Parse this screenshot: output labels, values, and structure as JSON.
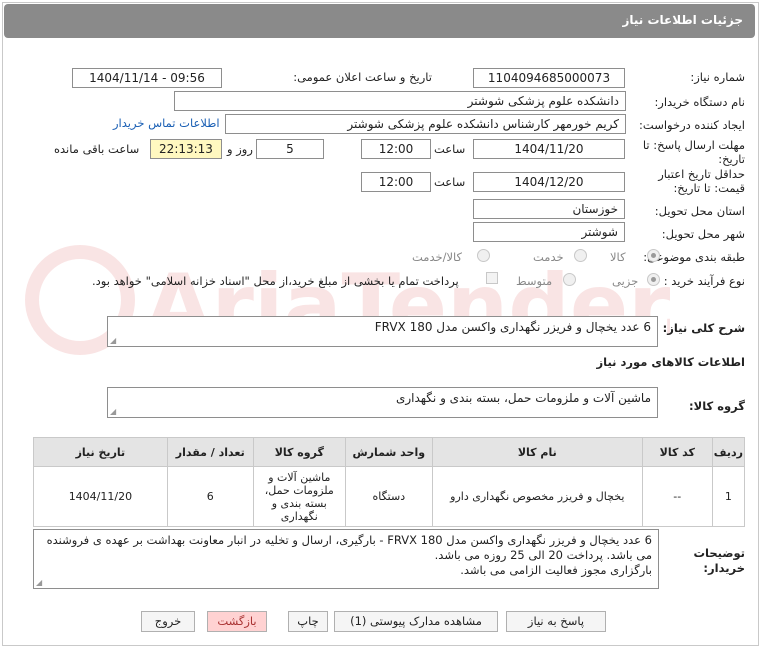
{
  "window": {
    "title": "جزئیات اطلاعات نیاز"
  },
  "labels": {
    "need_number": "شماره نیاز:",
    "announce_datetime": "تاریخ و ساعت اعلان عمومی:",
    "buyer_org": "نام دستگاه خریدار:",
    "requester": "ایجاد کننده درخواست:",
    "contact_link": "اطلاعات تماس خریدار",
    "reply_deadline_line1": "مهلت ارسال پاسخ: تا",
    "reply_deadline_line2": "تاریخ:",
    "time": "ساعت",
    "day_and": "روز و",
    "remaining": "ساعت باقی مانده",
    "min_validity_line1": "حداقل تاریخ اعتبار",
    "min_validity_line2": "قیمت: تا تاریخ:",
    "delivery_province": "استان محل تحویل:",
    "delivery_city": "شهر محل تحویل:",
    "category": "طبقه بندی موضوعی:",
    "process_type": "نوع فرآیند خرید :",
    "general_desc": "شرح کلی نیاز:",
    "goods_info": "اطلاعات کالاهای مورد نیاز",
    "goods_group": "گروه کالا:",
    "buyer_notes_line1": "توضیحات",
    "buyer_notes_line2": "خریدار:"
  },
  "values": {
    "need_number": "1104094685000073",
    "announce_datetime": "1404/11/14 - 09:56",
    "buyer_org": "دانشکده علوم پزشکی شوشتر",
    "requester": "کریم خورمهر کارشناس دانشکده علوم پزشکی شوشتر",
    "reply_date": "1404/11/20",
    "reply_time": "12:00",
    "reply_days": "5",
    "reply_remaining": "22:13:13",
    "validity_date": "1404/12/20",
    "validity_time": "12:00",
    "province": "خوزستان",
    "city": "شوشتر",
    "general_desc": "6 عدد یخچال و فریزر نگهداری واکسن مدل FRVX 180",
    "goods_group": "ماشین آلات و ملزومات حمل، بسته بندی و نگهداری",
    "buyer_notes": "6 عدد یخچال و فریزر نگهداری واکسن مدل FRVX 180 - بارگیری، ارسال و تخلیه در انبار معاونت بهداشت بر عهده ی فروشنده می باشد. پرداخت 20 الی 25 روزه می باشد.",
    "buyer_notes_2": "بارگزاری مجوز فعالیت الزامی می باشد."
  },
  "category_options": [
    {
      "label": "کالا",
      "selected": true
    },
    {
      "label": "خدمت",
      "selected": false
    },
    {
      "label": "کالا/خدمت",
      "selected": false
    }
  ],
  "process_options": [
    {
      "label": "جزیی",
      "selected": true
    },
    {
      "label": "متوسط",
      "selected": false
    }
  ],
  "process_note": "پرداخت تمام یا بخشی از مبلغ خرید،از محل \"اسناد خزانه اسلامی\" خواهد بود.",
  "table": {
    "headers": [
      "ردیف",
      "کد کالا",
      "نام کالا",
      "واحد شمارش",
      "گروه کالا",
      "تعداد / مقدار",
      "تاریخ نیاز"
    ],
    "rows": [
      [
        "1",
        "--",
        "یخچال و فریزر مخصوص نگهداری دارو",
        "دستگاه",
        "ماشین آلات و ملزومات حمل، بسته بندی و نگهداری",
        "6",
        "1404/11/20"
      ]
    ]
  },
  "buttons": {
    "reply": "پاسخ به نیاز",
    "view_docs": "مشاهده مدارک پیوستی (1)",
    "print": "چاپ",
    "back": "بازگشت",
    "exit": "خروج"
  },
  "watermark": "AriaTender.net",
  "colors": {
    "titlebar": "#8a8a8a",
    "link": "#1a5fb4",
    "remaining_bg": "#fff8c0",
    "back_bg": "#ffd2d2"
  }
}
